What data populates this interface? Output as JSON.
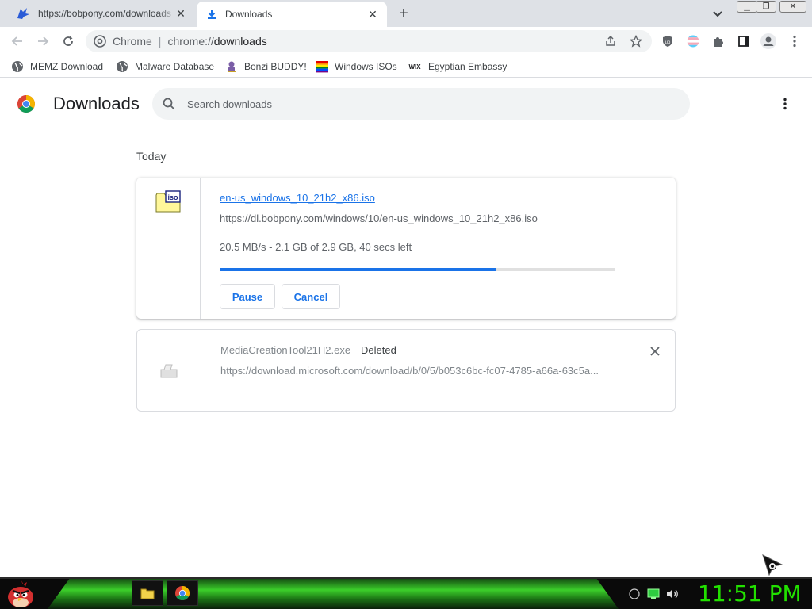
{
  "tabs": [
    {
      "title": "https://bobpony.com/downloads",
      "active": false
    },
    {
      "title": "Downloads",
      "active": true
    }
  ],
  "omnibox": {
    "site": "Chrome",
    "url_prefix": "chrome://",
    "url_path": "downloads"
  },
  "bookmarks": [
    {
      "label": "MEMZ Download",
      "icon": "globe-icon"
    },
    {
      "label": "Malware Database",
      "icon": "globe-icon"
    },
    {
      "label": "Bonzi BUDDY!",
      "icon": "bonzi-icon"
    },
    {
      "label": "Windows ISOs",
      "icon": "rainbow-flag-icon"
    },
    {
      "label": "Egyptian Embassy",
      "icon": "wix-icon"
    }
  ],
  "downloads_page": {
    "title": "Downloads",
    "search_placeholder": "Search downloads",
    "date_label": "Today"
  },
  "items": [
    {
      "filename": "en-us_windows_10_21h2_x86.iso",
      "url": "https://dl.bobpony.com/windows/10/en-us_windows_10_21h2_x86.iso",
      "status": "20.5 MB/s - 2.1 GB of 2.9 GB, 40 secs left",
      "progress": 0.7,
      "pause_label": "Pause",
      "cancel_label": "Cancel"
    },
    {
      "filename": "MediaCreationTool21H2.exe",
      "deleted_label": "Deleted",
      "url": "https://download.microsoft.com/download/b/0/5/b053c6bc-fc07-4785-a66a-63c5a..."
    }
  ],
  "taskbar": {
    "clock": "11:51 PM"
  },
  "colors": {
    "accent": "#1a73e8",
    "clock": "#22e000"
  }
}
